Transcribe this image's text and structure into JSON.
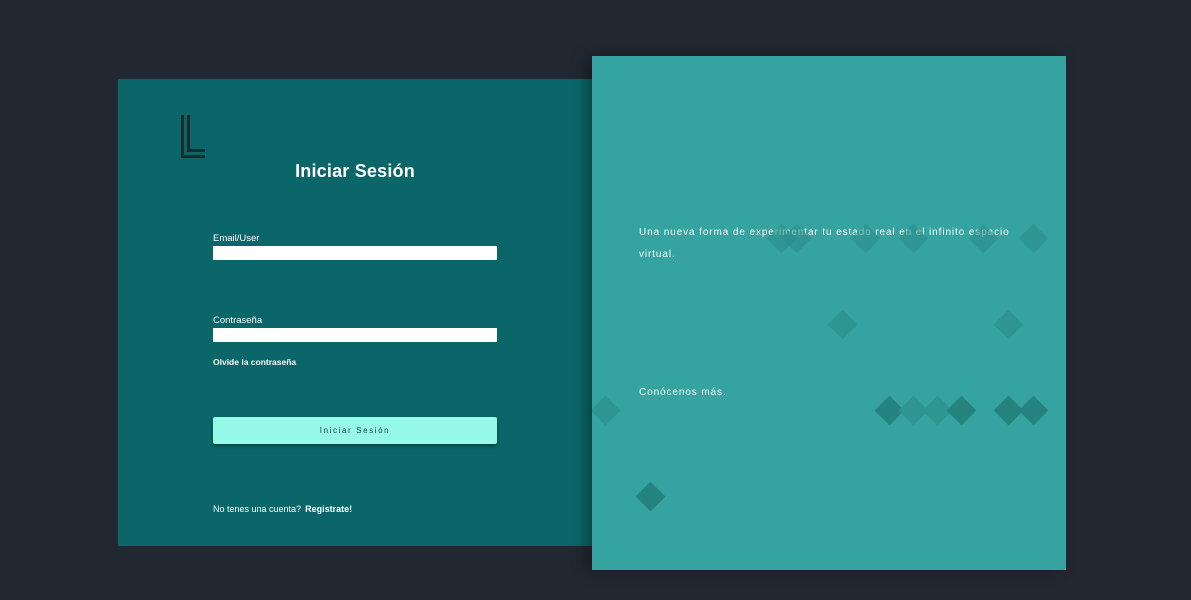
{
  "colors": {
    "page_background": "#222831",
    "login_panel": "#0a6669",
    "info_panel": "#35a39f",
    "button_accent": "#95fbe8"
  },
  "logo": {
    "icon": "L-logo-icon"
  },
  "login": {
    "title": "Iniciar Sesión",
    "email": {
      "label": "Email/User",
      "value": "",
      "placeholder": ""
    },
    "password": {
      "label": "Contraseña",
      "value": "",
      "placeholder": ""
    },
    "forgot_label": "Olvide la contraseña",
    "submit_label": "Iniciar Sesión",
    "register_prompt": "No tenes una cuenta?",
    "register_link": "Registrate!"
  },
  "info": {
    "tagline": "Una nueva forma de experimentar tu estado real en el infinito espacio virtual.",
    "know_more": "Conócenos más."
  }
}
